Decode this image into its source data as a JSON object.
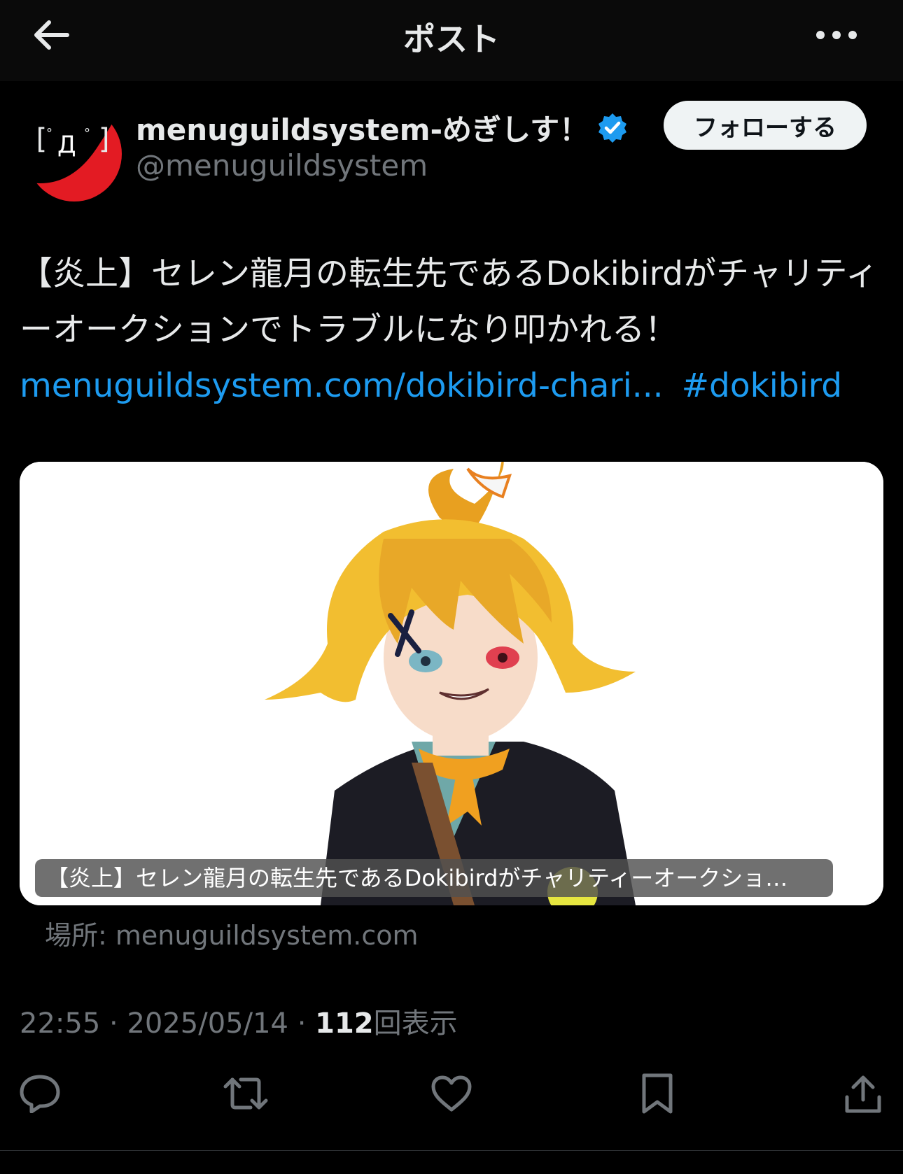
{
  "header": {
    "title": "ポスト",
    "back_icon": "arrow-left-icon",
    "more_icon": "more-horizontal-icon"
  },
  "author": {
    "name": "menuguildsystem-めぎしす！",
    "handle": "@menuguildsystem",
    "verified": true,
    "avatar_text": "[°Д°]",
    "avatar_color": "#e31b23"
  },
  "follow_button": {
    "label": "フォローする"
  },
  "post": {
    "text": "【炎上】セレン龍月の転生先であるDokibirdがチャリティーオークションでトラブルになり叩かれる！",
    "link": "menuguildsystem.com/dokibird-chari...",
    "hashtag": "#dokibird"
  },
  "card": {
    "title": "【炎上】セレン龍月の転生先であるDokibirdがチャリティーオークショ…",
    "source": "場所: menuguildsystem.com"
  },
  "meta": {
    "time": "22:55",
    "separator": " · ",
    "date": "2025/05/14",
    "views_count": "112",
    "views_label": "回表示"
  },
  "actions": {
    "reply_icon": "reply-icon",
    "retweet_icon": "retweet-icon",
    "like_icon": "heart-icon",
    "bookmark_icon": "bookmark-icon",
    "share_icon": "share-icon"
  },
  "colors": {
    "background": "#000000",
    "link": "#1d9bf0",
    "secondary_text": "#71767b",
    "primary_text": "#e7e9ea",
    "verified_badge": "#1d9bf0"
  }
}
